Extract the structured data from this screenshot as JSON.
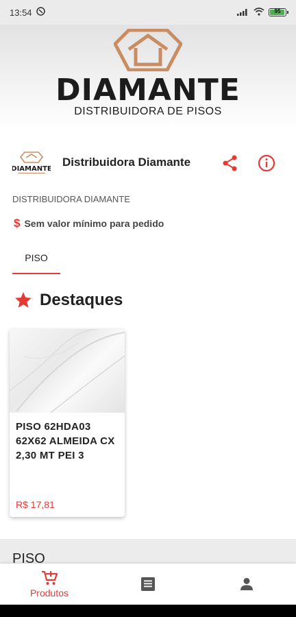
{
  "status": {
    "time": "13:54",
    "battery": "95",
    "battery_level": 0.95
  },
  "banner": {
    "brand": "DIAMANTE",
    "subtitle": "DISTRIBUIDORA DE PISOS"
  },
  "store": {
    "name": "Distribuidora Diamante",
    "label": "DISTRIBUIDORA DIAMANTE",
    "logo_text": "DIAMANTE",
    "min_order_symbol": "$",
    "min_order": "Sem valor mínimo para pedido"
  },
  "tabs": [
    {
      "label": "PISO",
      "active": true
    }
  ],
  "highlights": {
    "title": "Destaques",
    "products": [
      {
        "name": "PISO 62HDA03 62X62 ALMEIDA CX 2,30 MT PEI 3",
        "price": "R$ 17,81"
      }
    ]
  },
  "list_section": {
    "title": "PISO"
  },
  "bottom_nav": {
    "items": [
      {
        "label": "Produtos",
        "icon": "cart-icon",
        "active": true
      },
      {
        "label": "",
        "icon": "orders-icon",
        "active": false
      },
      {
        "label": "",
        "icon": "profile-icon",
        "active": false
      }
    ]
  },
  "colors": {
    "accent": "#e53935",
    "brand_copper": "#c98d63"
  }
}
